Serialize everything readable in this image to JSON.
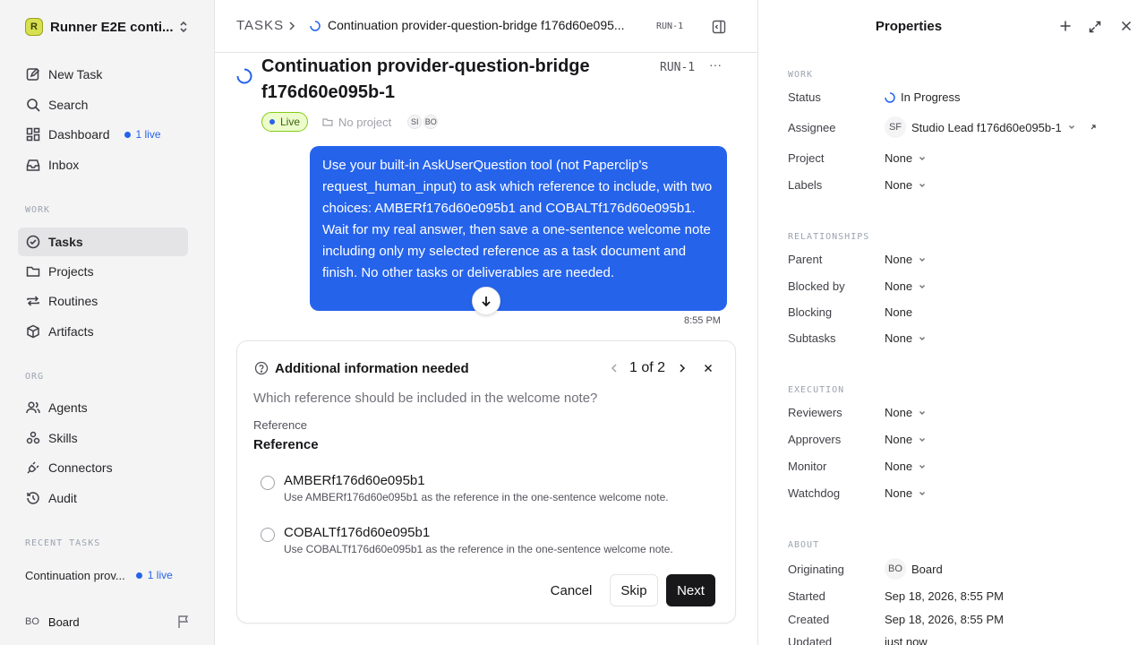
{
  "sidebar": {
    "workspace_name": "Runner E2E conti...",
    "workspace_initial": "R",
    "top_items": [
      {
        "label": "New Task"
      },
      {
        "label": "Search"
      },
      {
        "label": "Dashboard",
        "badge": "1 live"
      },
      {
        "label": "Inbox"
      }
    ],
    "work_title": "WORK",
    "work_items": [
      {
        "label": "Tasks"
      },
      {
        "label": "Projects"
      },
      {
        "label": "Routines"
      },
      {
        "label": "Artifacts"
      }
    ],
    "org_title": "ORG",
    "org_items": [
      {
        "label": "Agents"
      },
      {
        "label": "Skills"
      },
      {
        "label": "Connectors"
      },
      {
        "label": "Audit"
      }
    ],
    "recent_title": "RECENT TASKS",
    "recent": {
      "label": "Continuation prov...",
      "badge": "1 live"
    },
    "user": {
      "initials": "BO",
      "name": "Board"
    }
  },
  "header": {
    "root": "TASKS",
    "title": "Continuation provider-question-bridge f176d60e095...",
    "id": "RUN-1"
  },
  "task": {
    "title": "Continuation provider-question-bridge f176d60e095b-1",
    "id": "RUN-1",
    "more": "···",
    "live_label": "Live",
    "project_label": "No project",
    "avatars": [
      "SI",
      "BO"
    ]
  },
  "message": {
    "text": "Use your built-in AskUserQuestion tool (not Paperclip's request_human_input) to ask which reference to include, with two choices: AMBERf176d60e095b1 and COBALTf176d60e095b1. Wait for my real answer, then save a one-sentence welcome note including only my selected reference as a task document and finish. No other tasks or deliverables are needed.",
    "time": "8:55 PM"
  },
  "question_card": {
    "title": "Additional information needed",
    "pager": "1 of 2",
    "question": "Which reference should be included in the welcome note?",
    "field_label": "Reference",
    "field_heading": "Reference",
    "options": [
      {
        "label": "AMBERf176d60e095b1",
        "description": "Use AMBERf176d60e095b1 as the reference in the one-sentence welcome note."
      },
      {
        "label": "COBALTf176d60e095b1",
        "description": "Use COBALTf176d60e095b1 as the reference in the one-sentence welcome note."
      }
    ],
    "cancel_label": "Cancel",
    "skip_label": "Skip",
    "next_label": "Next"
  },
  "properties": {
    "title": "Properties",
    "work_title": "WORK",
    "status_key": "Status",
    "status_val": "In Progress",
    "assignee_key": "Assignee",
    "assignee_initials": "SF",
    "assignee_val": "Studio Lead f176d60e095b-1",
    "project_key": "Project",
    "project_val": "None",
    "labels_key": "Labels",
    "labels_val": "None",
    "rel_title": "RELATIONSHIPS",
    "parent_key": "Parent",
    "parent_val": "None",
    "blockedby_key": "Blocked by",
    "blockedby_val": "None",
    "blocking_key": "Blocking",
    "blocking_val": "None",
    "subtasks_key": "Subtasks",
    "subtasks_val": "None",
    "exec_title": "EXECUTION",
    "reviewers_key": "Reviewers",
    "reviewers_val": "None",
    "approvers_key": "Approvers",
    "approvers_val": "None",
    "monitor_key": "Monitor",
    "monitor_val": "None",
    "watchdog_key": "Watchdog",
    "watchdog_val": "None",
    "about_title": "ABOUT",
    "orig_key": "Originating",
    "orig_initials": "BO",
    "orig_val": "Board",
    "started_key": "Started",
    "started_val": "Sep 18, 2026, 8:55 PM",
    "created_key": "Created",
    "created_val": "Sep 18, 2026, 8:55 PM",
    "updated_key": "Updated",
    "updated_val": "just now"
  },
  "colors": {
    "accent": "#2563eb",
    "live_bg": "#ecfccb",
    "primary_button": "#18181b"
  }
}
